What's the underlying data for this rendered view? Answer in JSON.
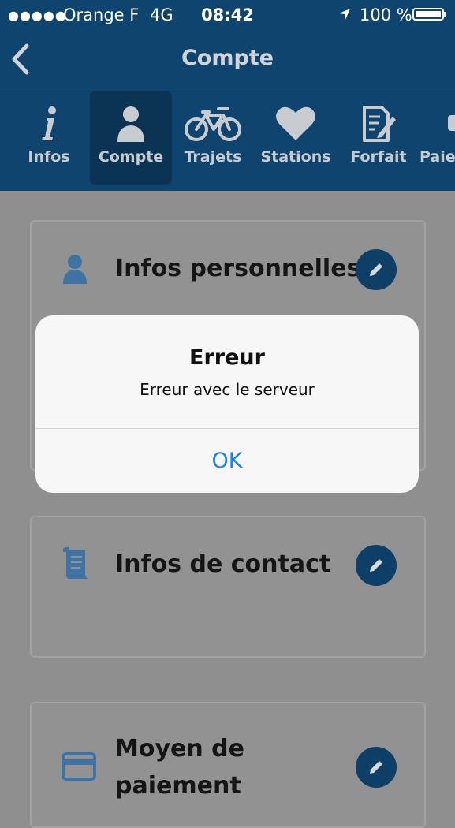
{
  "status_bar": {
    "signal": "●●●●●",
    "carrier": "Orange F",
    "network": "4G",
    "time": "08:42",
    "battery": "100 %"
  },
  "nav": {
    "title": "Compte",
    "back_icon": "chevron-left-icon"
  },
  "tabs": [
    {
      "label": "Infos",
      "icon": "info-icon"
    },
    {
      "label": "Compte",
      "icon": "user-icon",
      "active": true
    },
    {
      "label": "Trajets",
      "icon": "bicycle-icon"
    },
    {
      "label": "Stations",
      "icon": "heart-icon"
    },
    {
      "label": "Forfait",
      "icon": "document-edit-icon"
    },
    {
      "label": "Paiem",
      "icon": "plug-icon"
    }
  ],
  "cards": [
    {
      "title": "Infos personnelles",
      "icon": "user-icon"
    },
    {
      "title": "Infos de contact",
      "icon": "scroll-icon"
    },
    {
      "title_line1": "Moyen de",
      "title_line2": "paiement",
      "icon": "credit-card-icon"
    }
  ],
  "alert": {
    "title": "Erreur",
    "message": "Erreur avec le serveur",
    "ok_label": "OK"
  },
  "colors": {
    "bar": "#0f446f",
    "accent": "#1b82f0",
    "edit_button": "#0e3f66",
    "card_icon": "#3f73a4"
  }
}
